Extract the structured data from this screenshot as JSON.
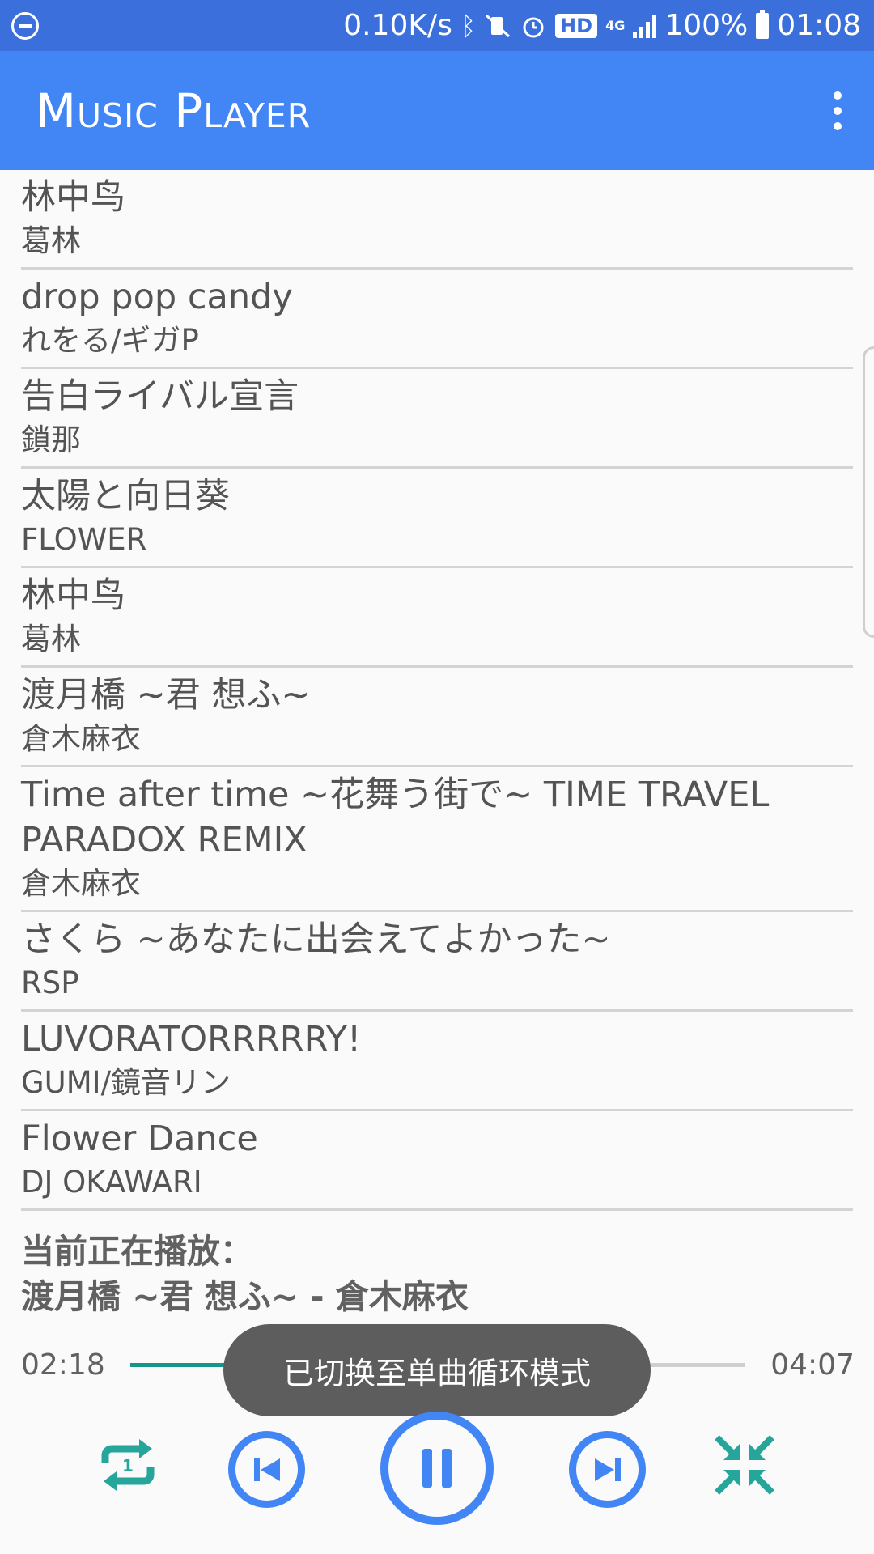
{
  "status_bar": {
    "speed": "0.10K/s",
    "hd": "HD",
    "network": "4G",
    "battery": "100%",
    "time": "01:08"
  },
  "app_bar": {
    "title": "Music Player"
  },
  "songs": [
    {
      "title": "林中鸟",
      "artist": "葛林"
    },
    {
      "title": "drop pop candy",
      "artist": "れをる/ギガP"
    },
    {
      "title": "告白ライバル宣言",
      "artist": "鎖那"
    },
    {
      "title": "太陽と向日葵",
      "artist": "FLOWER"
    },
    {
      "title": "林中鸟",
      "artist": "葛林"
    },
    {
      "title": "渡月橋 ~君 想ふ~",
      "artist": "倉木麻衣"
    },
    {
      "title": "Time after time ~花舞う街で~ TIME TRAVEL PARADOX REMIX",
      "artist": "倉木麻衣"
    },
    {
      "title": "さくら ~あなたに出会えてよかった~",
      "artist": "RSP"
    },
    {
      "title": "LUVORATORRRRRY!",
      "artist": "GUMI/鏡音リン"
    },
    {
      "title": "Flower Dance",
      "artist": "DJ OKAWARI"
    }
  ],
  "now_playing": {
    "label": "当前正在播放：",
    "track": "渡月橋 ~君 想ふ~ - 倉木麻衣"
  },
  "progress": {
    "current": "02:18",
    "total": "04:07",
    "fraction": 0.56
  },
  "toast": {
    "message": "已切换至单曲循环模式"
  },
  "controls": {
    "repeat_icon": "repeat-one-icon",
    "prev_icon": "skip-previous-icon",
    "pause_icon": "pause-icon",
    "next_icon": "skip-next-icon",
    "shrink_icon": "collapse-arrows-icon"
  },
  "colors": {
    "status_bar": "#3a6fdc",
    "app_bar": "#4285f4",
    "accent_teal": "#14968a",
    "control_blue": "#4285f4",
    "control_green": "#26a69a"
  }
}
